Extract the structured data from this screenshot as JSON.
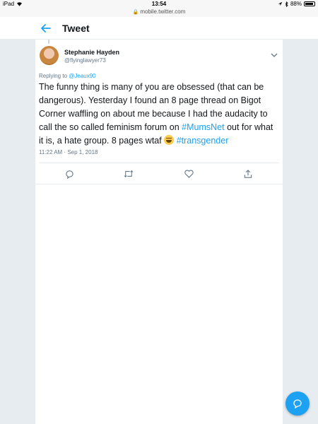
{
  "status_bar": {
    "device": "iPad",
    "time": "13:54",
    "battery": "88%",
    "url": "mobile.twitter.com"
  },
  "header": {
    "title": "Tweet",
    "back_icon": "arrow-left-icon"
  },
  "tweet": {
    "author_name": "Stephanie Hayden",
    "author_handle": "@flyinglawyer73",
    "reply_prefix": "Replying to",
    "reply_to": "@Jeaux90",
    "text_part1": "The funny thing is many of you are obsessed (that can be dangerous). Yesterday I found an 8 page thread on Bigot Corner waffling on about me because I had the audacity to call the so called feminism forum on ",
    "hashtag1": "#MumsNet",
    "text_part2": " out for what it is, a hate group. 8 pages wtaf ",
    "hashtag2": "#transgender",
    "timestamp": "11:22 AM · Sep 1, 2018"
  },
  "actions": [
    "reply-icon",
    "retweet-icon",
    "like-icon",
    "share-icon"
  ],
  "fab_icon": "compose-icon",
  "colors": {
    "accent": "#1da1f2",
    "background": "#e6ecf0",
    "secondary_text": "#657786"
  }
}
